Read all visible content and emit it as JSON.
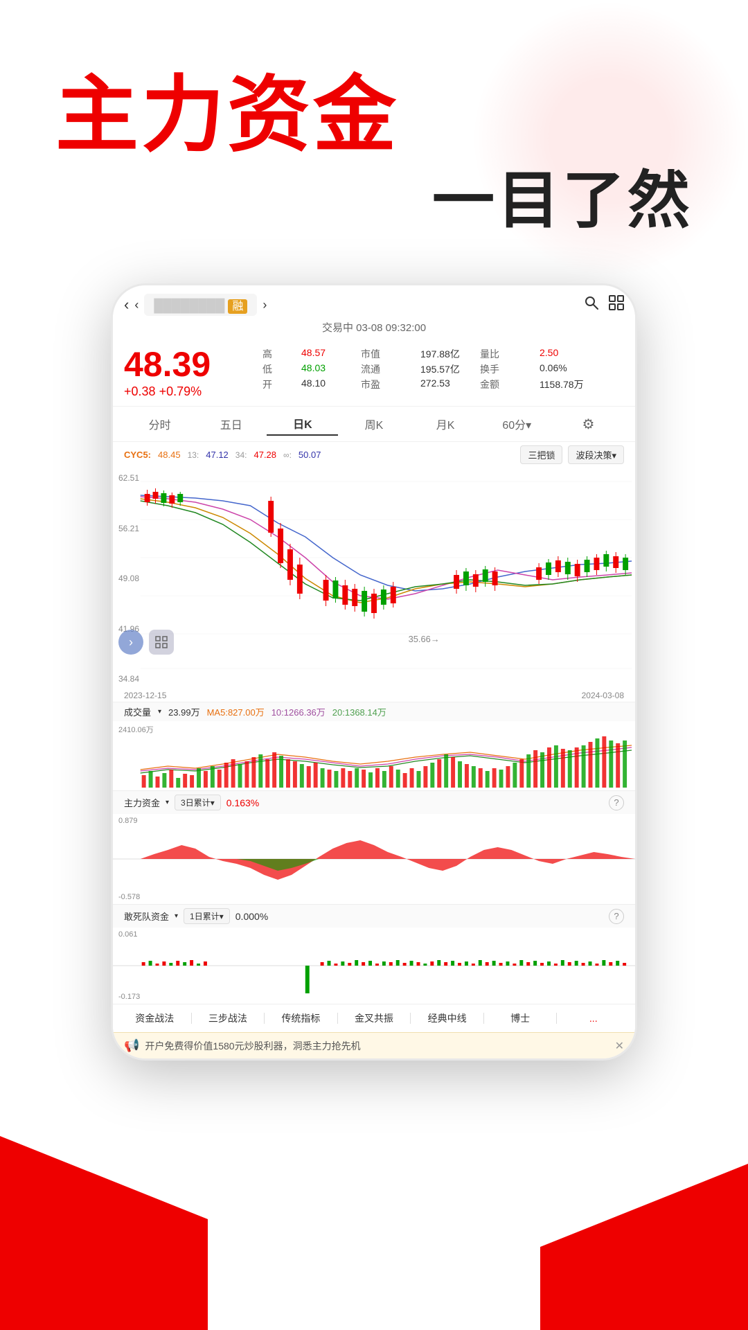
{
  "hero": {
    "title_main": "主力资金",
    "title_sub": "一目了然"
  },
  "app": {
    "nav": {
      "back_arrow": "‹",
      "prev_arrow": "‹",
      "stock_name": "████████",
      "rong_badge": "融",
      "next_arrow": "›",
      "search_icon": "🔍",
      "layout_icon": "⊞"
    },
    "status": "交易中 03-08 09:32:00",
    "price": {
      "current": "48.39",
      "change": "+0.38",
      "change_pct": "+0.79%",
      "high_label": "高",
      "high_val": "48.57",
      "low_label": "低",
      "low_val": "48.03",
      "open_label": "开",
      "open_val": "48.10",
      "market_cap_label": "市值",
      "market_cap_val": "197.88亿",
      "circulation_label": "流通",
      "circulation_val": "195.57亿",
      "pe_label": "市盈",
      "pe_val": "272.53",
      "vol_ratio_label": "量比",
      "vol_ratio_val": "2.50",
      "turnover_label": "换手",
      "turnover_val": "0.06%",
      "amount_label": "金额",
      "amount_val": "1158.78万"
    },
    "chart_tabs": [
      {
        "label": "分时",
        "active": false
      },
      {
        "label": "五日",
        "active": false
      },
      {
        "label": "日K",
        "active": true
      },
      {
        "label": "周K",
        "active": false
      },
      {
        "label": "月K",
        "active": false
      },
      {
        "label": "60分▾",
        "active": false
      }
    ],
    "cyc": {
      "label": "CYC5:",
      "v1": "48.45",
      "sep1": "13:",
      "v2": "47.12",
      "sep2": "34:",
      "v3": "47.28",
      "sep3": "∞:",
      "v4": "50.07",
      "btn1": "三把锁",
      "btn2": "波段决策",
      "btn2_arrow": "▾"
    },
    "chart_y_labels": [
      "62.51",
      "56.21",
      "49.08",
      "41.96",
      "34.84"
    ],
    "chart_x_labels": [
      "2023-12-15",
      "2024-03-08"
    ],
    "chart_annotation": "35.66→",
    "volume": {
      "label": "成交量",
      "arrow": "▾",
      "val": "23.99万",
      "ma5_label": "MA5:",
      "ma5_val": "827.00万",
      "ma10_label": "10:",
      "ma10_val": "1266.36万",
      "ma20_label": "20:",
      "ma20_val": "1368.14万",
      "y_label": "2410.06万"
    },
    "main_force": {
      "label": "主力资金",
      "arrow": "▾",
      "period_label": "3日累计",
      "period_arrow": "▾",
      "pct": "0.163%",
      "y_top": "0.879",
      "y_bottom": "-0.578"
    },
    "suicide_squad": {
      "label": "敢死队资金",
      "arrow": "▾",
      "period_label": "1日累计",
      "period_arrow": "▾",
      "pct": "0.000%",
      "y_top": "0.061",
      "y_bottom": "-0.173"
    },
    "bottom_tabs": [
      "资金战法",
      "三步战法",
      "传统指标",
      "金叉共振",
      "经典中线",
      "博士",
      "..."
    ],
    "banner": {
      "text": "开户免费得价值1580元炒股利器，洞悉主力抢先机"
    }
  },
  "colors": {
    "red": "#e00000",
    "green": "#00a000",
    "orange": "#e87010",
    "blue_line": "#4466cc",
    "pink_line": "#cc44aa",
    "gold_line": "#cc8800",
    "dark_green_line": "#228822"
  }
}
